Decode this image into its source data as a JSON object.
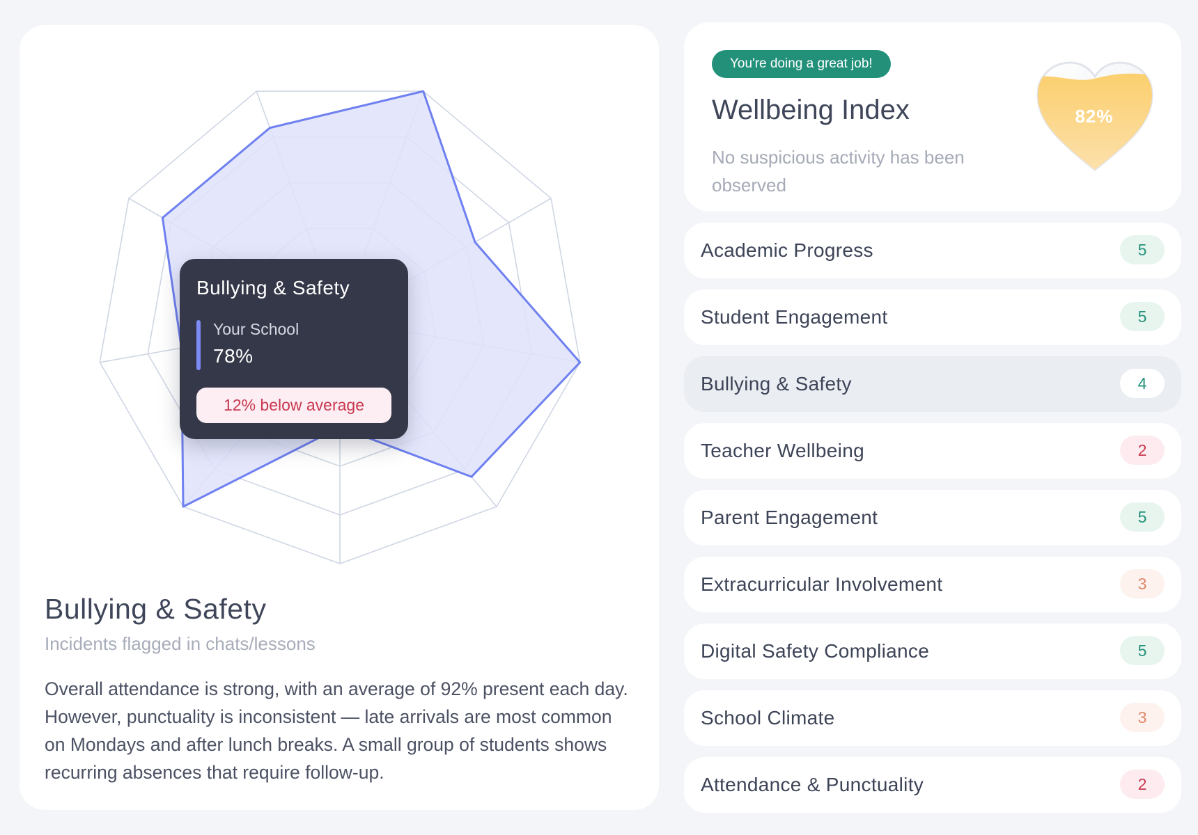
{
  "radar": {
    "axis_count": 9,
    "max": 5,
    "rings": 5,
    "series": [
      {
        "values": [
          4.2,
          5.0,
          3.2,
          5.0,
          4.2,
          2.2,
          5.0,
          3.3,
          4.2
        ],
        "color": "#6f80f0",
        "fill": "#dfe3fb"
      }
    ],
    "highlight_index": 5
  },
  "tooltip": {
    "title": "Bullying & Safety",
    "series_label": "Your School",
    "value": "78%",
    "comparison": "12% below average"
  },
  "detail": {
    "title": "Bullying & Safety",
    "subtitle": "Incidents flagged in chats/lessons",
    "body": "Overall attendance is strong, with an average of 92% present each day. However, punctuality is inconsistent — late arrivals are most common on Mondays and after lunch breaks. A small group of students shows recurring absences that require follow-up."
  },
  "wellbeing": {
    "badge": "You're doing a great job!",
    "title": "Wellbeing Index",
    "description": "No suspicious activity has been observed",
    "score": "82%",
    "score_fraction": 0.82
  },
  "metrics": [
    {
      "label": "Academic Progress",
      "value": "5",
      "tone": "green"
    },
    {
      "label": "Student Engagement",
      "value": "5",
      "tone": "green"
    },
    {
      "label": "Bullying & Safety",
      "value": "4",
      "tone": "white",
      "active": true
    },
    {
      "label": "Teacher Wellbeing",
      "value": "2",
      "tone": "red"
    },
    {
      "label": "Parent Engagement",
      "value": "5",
      "tone": "green"
    },
    {
      "label": "Extracurricular Involvement",
      "value": "3",
      "tone": "orange"
    },
    {
      "label": "Digital Safety Compliance",
      "value": "5",
      "tone": "green"
    },
    {
      "label": "School Climate",
      "value": "3",
      "tone": "orange"
    },
    {
      "label": "Attendance & Punctuality",
      "value": "2",
      "tone": "red"
    }
  ],
  "colors": {
    "accent": "#6f80f0",
    "badge_green": "#23917a",
    "tooltip_bg": "#353849",
    "warning_red": "#c8374f"
  }
}
